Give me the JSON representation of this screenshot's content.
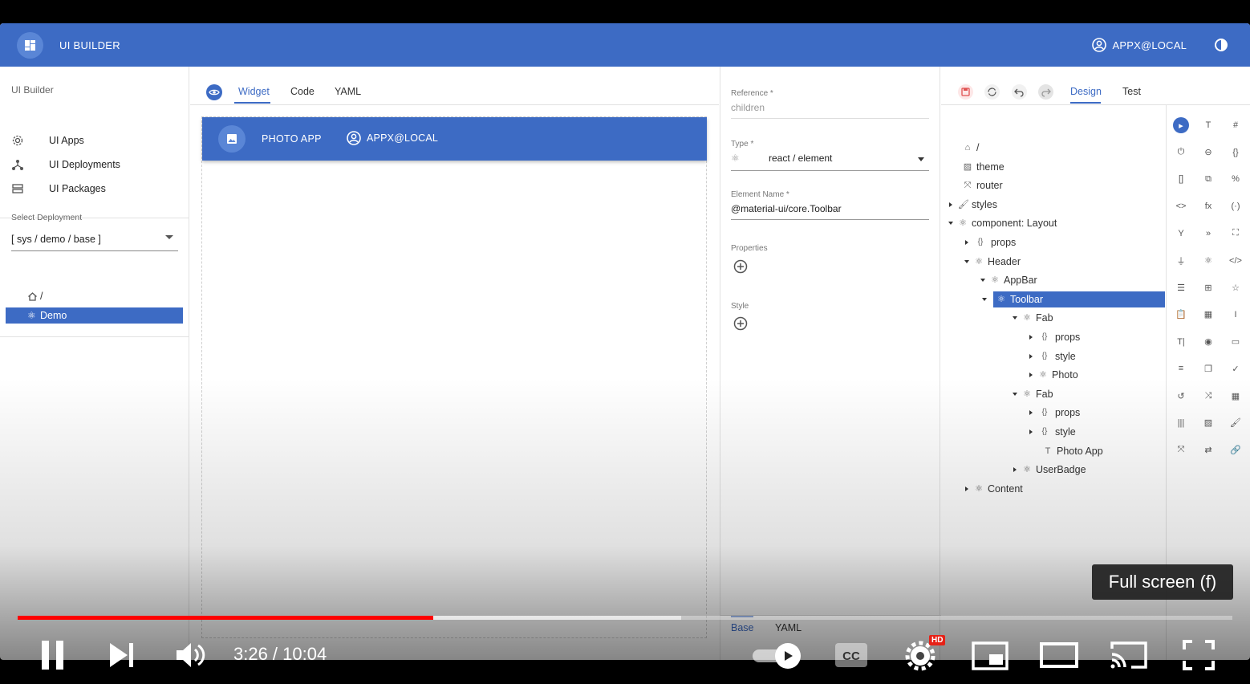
{
  "app": {
    "title": "UI BUILDER",
    "user": "APPX@LOCAL",
    "accent": "#3d6bc4"
  },
  "sidebar": {
    "section_title": "UI Builder",
    "items": [
      {
        "label": "UI Apps",
        "icon": "gear-icon"
      },
      {
        "label": "UI Deployments",
        "icon": "fork-icon"
      },
      {
        "label": "UI Packages",
        "icon": "storage-icon"
      }
    ],
    "select_label": "Select Deployment",
    "select_value": "[ sys / demo / base ]",
    "tree": [
      {
        "label": "/",
        "icon": "home-icon"
      },
      {
        "label": "Demo",
        "icon": "react-icon",
        "active": true
      }
    ]
  },
  "center": {
    "tabs": [
      "Widget",
      "Code",
      "YAML"
    ],
    "active_tab": "Widget",
    "preview": {
      "title": "PHOTO APP",
      "user": "APPX@LOCAL"
    }
  },
  "props": {
    "reference_label": "Reference *",
    "reference_value": "children",
    "type_label": "Type *",
    "type_value": "react / element",
    "element_name_label": "Element Name *",
    "element_name_value": "@material-ui/core.Toolbar",
    "properties_label": "Properties",
    "style_label": "Style",
    "bottom_tabs": [
      "Base",
      "YAML"
    ],
    "active_bottom_tab": "Base"
  },
  "tree_panel": {
    "tabs": [
      "Design",
      "Test"
    ],
    "active_tab": "Design",
    "nodes": [
      {
        "label": "/",
        "icon": "home-icon",
        "depth": 0,
        "arrow": "none"
      },
      {
        "label": "theme",
        "icon": "image-icon",
        "depth": 0,
        "arrow": "none"
      },
      {
        "label": "router",
        "icon": "router-icon",
        "depth": 0,
        "arrow": "none"
      },
      {
        "label": "styles",
        "icon": "paint-icon",
        "depth": 0,
        "arrow": "right"
      },
      {
        "label": "component: Layout",
        "icon": "react-icon",
        "depth": 0,
        "arrow": "down"
      },
      {
        "label": "props",
        "icon": "braces-icon",
        "depth": 1,
        "arrow": "right"
      },
      {
        "label": "Header",
        "icon": "react-icon",
        "depth": 1,
        "arrow": "down"
      },
      {
        "label": "AppBar",
        "icon": "react-icon",
        "depth": 2,
        "arrow": "down"
      },
      {
        "label": "Toolbar",
        "icon": "react-icon",
        "depth": 3,
        "arrow": "down",
        "selected": true
      },
      {
        "label": "Fab",
        "icon": "react-icon",
        "depth": 4,
        "arrow": "down"
      },
      {
        "label": "props",
        "icon": "braces-icon",
        "depth": 5,
        "arrow": "right"
      },
      {
        "label": "style",
        "icon": "braces-icon",
        "depth": 5,
        "arrow": "right"
      },
      {
        "label": "Photo",
        "icon": "react-icon",
        "depth": 5,
        "arrow": "right"
      },
      {
        "label": "Fab",
        "icon": "react-icon",
        "depth": 4,
        "arrow": "down"
      },
      {
        "label": "props",
        "icon": "braces-icon",
        "depth": 5,
        "arrow": "right"
      },
      {
        "label": "style",
        "icon": "braces-icon",
        "depth": 5,
        "arrow": "right"
      },
      {
        "label": "Photo App",
        "icon": "text-icon",
        "depth": 5,
        "arrow": "none"
      },
      {
        "label": "UserBadge",
        "icon": "react-icon",
        "depth": 4,
        "arrow": "right"
      },
      {
        "label": "Content",
        "icon": "react-icon",
        "depth": 1,
        "arrow": "right"
      }
    ],
    "palette_glyphs": [
      "▸",
      "T",
      "#",
      "⏻",
      "⊖",
      "{}",
      "[]",
      "⧉",
      "%",
      "<>",
      "fx",
      "(·)",
      "Y",
      "»",
      "⛶",
      "⏚",
      "⚛",
      "</>",
      "☰",
      "⊞",
      "☆",
      "📋",
      "▦",
      "I",
      "T|",
      "◉",
      "▭",
      "≡",
      "❐",
      "✓",
      "↺",
      "⤨",
      "▦",
      "|||",
      "▨",
      "🖌",
      "⤧",
      "⇄",
      "🔗"
    ]
  },
  "player": {
    "time": "3:26 / 10:04",
    "tooltip": "Full screen (f)",
    "hd": "HD",
    "played_fraction": 0.342,
    "buffered_fraction": 0.546
  }
}
